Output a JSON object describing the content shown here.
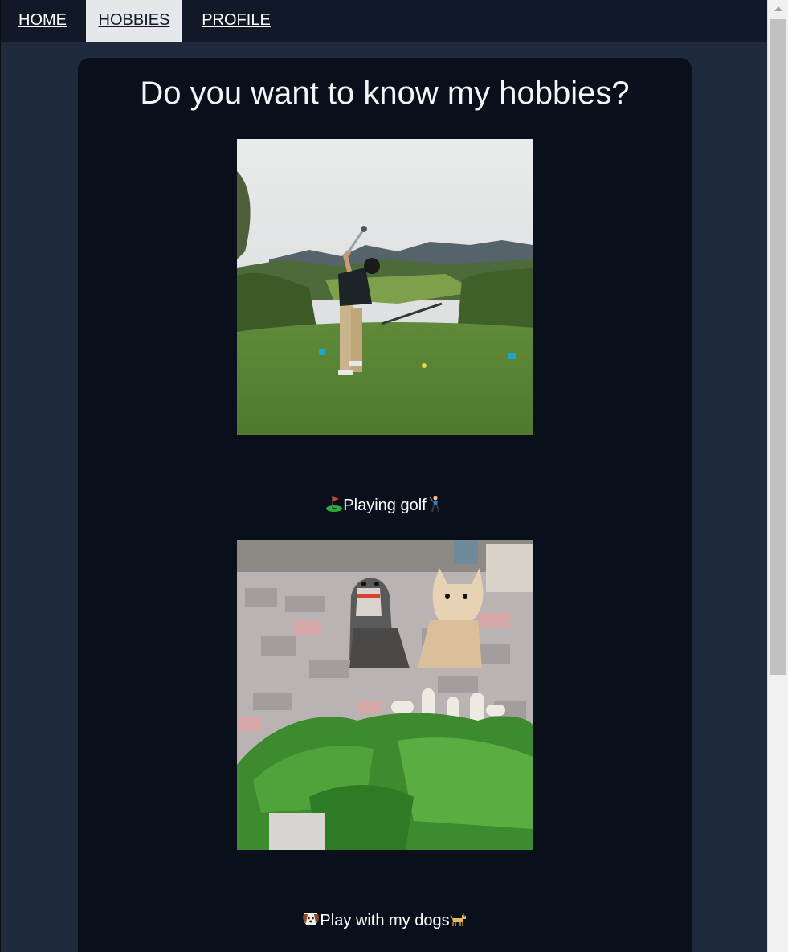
{
  "nav": {
    "items": [
      {
        "label": "HOME",
        "active": false
      },
      {
        "label": "HOBBIES",
        "active": true
      },
      {
        "label": "PROFILE",
        "active": false
      }
    ]
  },
  "main": {
    "title": "Do you want to know my hobbies?",
    "hobbies": [
      {
        "image": "golf-swing-photo",
        "caption": "Playing golf",
        "emoji_before": "golf-flag-icon",
        "emoji_after": "golfer-icon"
      },
      {
        "image": "two-dogs-with-radishes-photo",
        "caption": "Play with my dogs",
        "emoji_before": "dog-face-icon",
        "emoji_after": "dog-icon"
      }
    ]
  },
  "colors": {
    "page_background": "#1f2a3d",
    "nav_background": "#111827",
    "nav_active_background": "#e5e7eb",
    "card_background": "#0a0f1c",
    "text": "#ffffff"
  }
}
